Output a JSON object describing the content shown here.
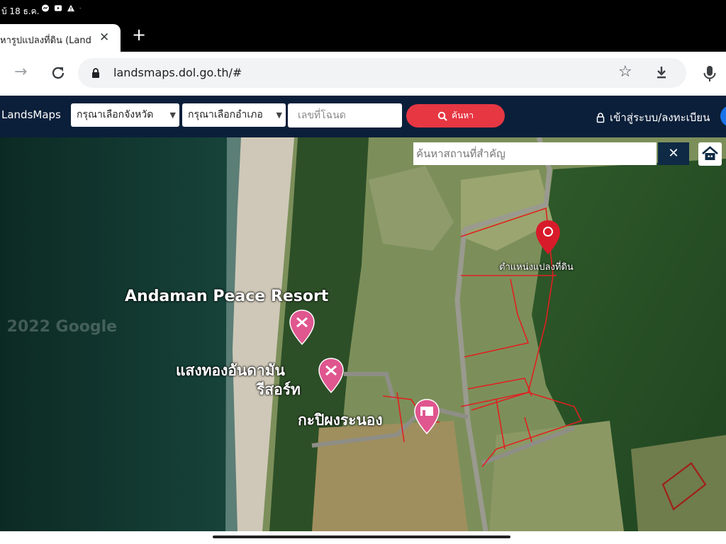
{
  "statusbar": {
    "time": "บ้ 18 ธ.ค."
  },
  "browser": {
    "tab_title": "หารูปแปลงที่ดิน (Land",
    "close_glyph": "✕",
    "new_tab_glyph": "+",
    "url": "landsmaps.dol.go.th/#"
  },
  "app": {
    "brand": "LandsMaps",
    "province_select": "กรุณาเลือกจังหวัด",
    "district_select": "กรุณาเลือกอำเภอ",
    "deed_placeholder": "เลขที่โฉนด",
    "search_label": "ค้นหา",
    "login_label": "เข้าสู่ระบบ/ลงทะเบียน"
  },
  "map": {
    "place_search_placeholder": "ค้นหาสถานที่สำคัญ",
    "close_glyph": "✕",
    "labels": {
      "resort_en": "Andaman Peace Resort",
      "resort_th_1": "แสงทองอันดามัน",
      "resort_th_2": "รีสอร์ท",
      "local_place": "กะปิผงระนอง",
      "parcel_label": "ตำแหน่งแปลงที่ดิน",
      "watermark": "© 2022 Google"
    }
  },
  "colors": {
    "navbar": "#0b1f3a",
    "accent": "#e63743",
    "parcel": "#e02020"
  }
}
